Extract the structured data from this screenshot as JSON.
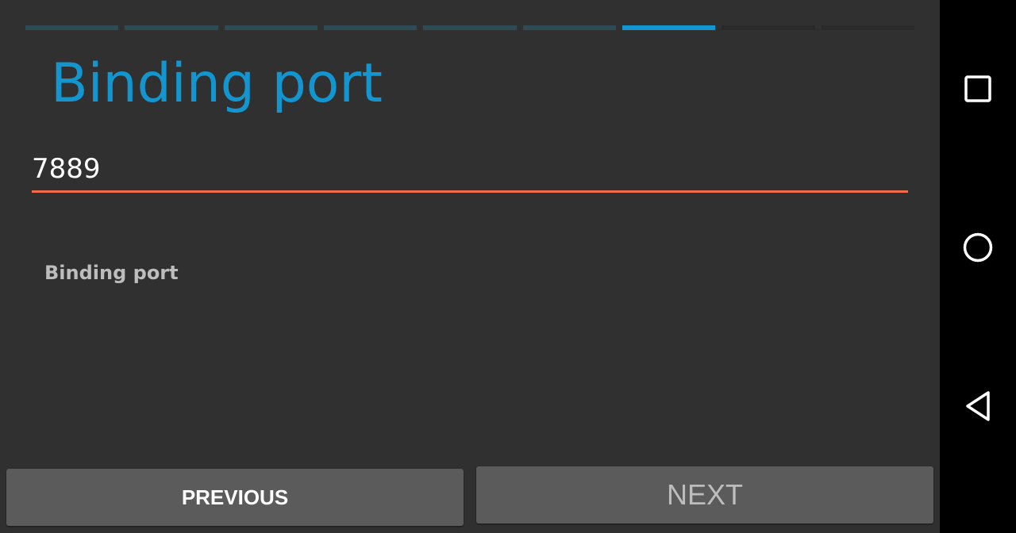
{
  "wizard": {
    "progress": {
      "total_steps": 9,
      "current_step": 7
    },
    "title": "Binding port",
    "port_value": "7889",
    "description": "Binding port",
    "previous_label": "PREVIOUS",
    "next_label": "NEXT"
  },
  "navbar": {
    "buttons": [
      {
        "icon": "recents-icon"
      },
      {
        "icon": "home-icon"
      },
      {
        "icon": "back-icon"
      }
    ]
  },
  "colors": {
    "accent": "#1396cf",
    "input_underline": "#f26b4b",
    "background": "#303030",
    "button": "#5b5b5b"
  }
}
